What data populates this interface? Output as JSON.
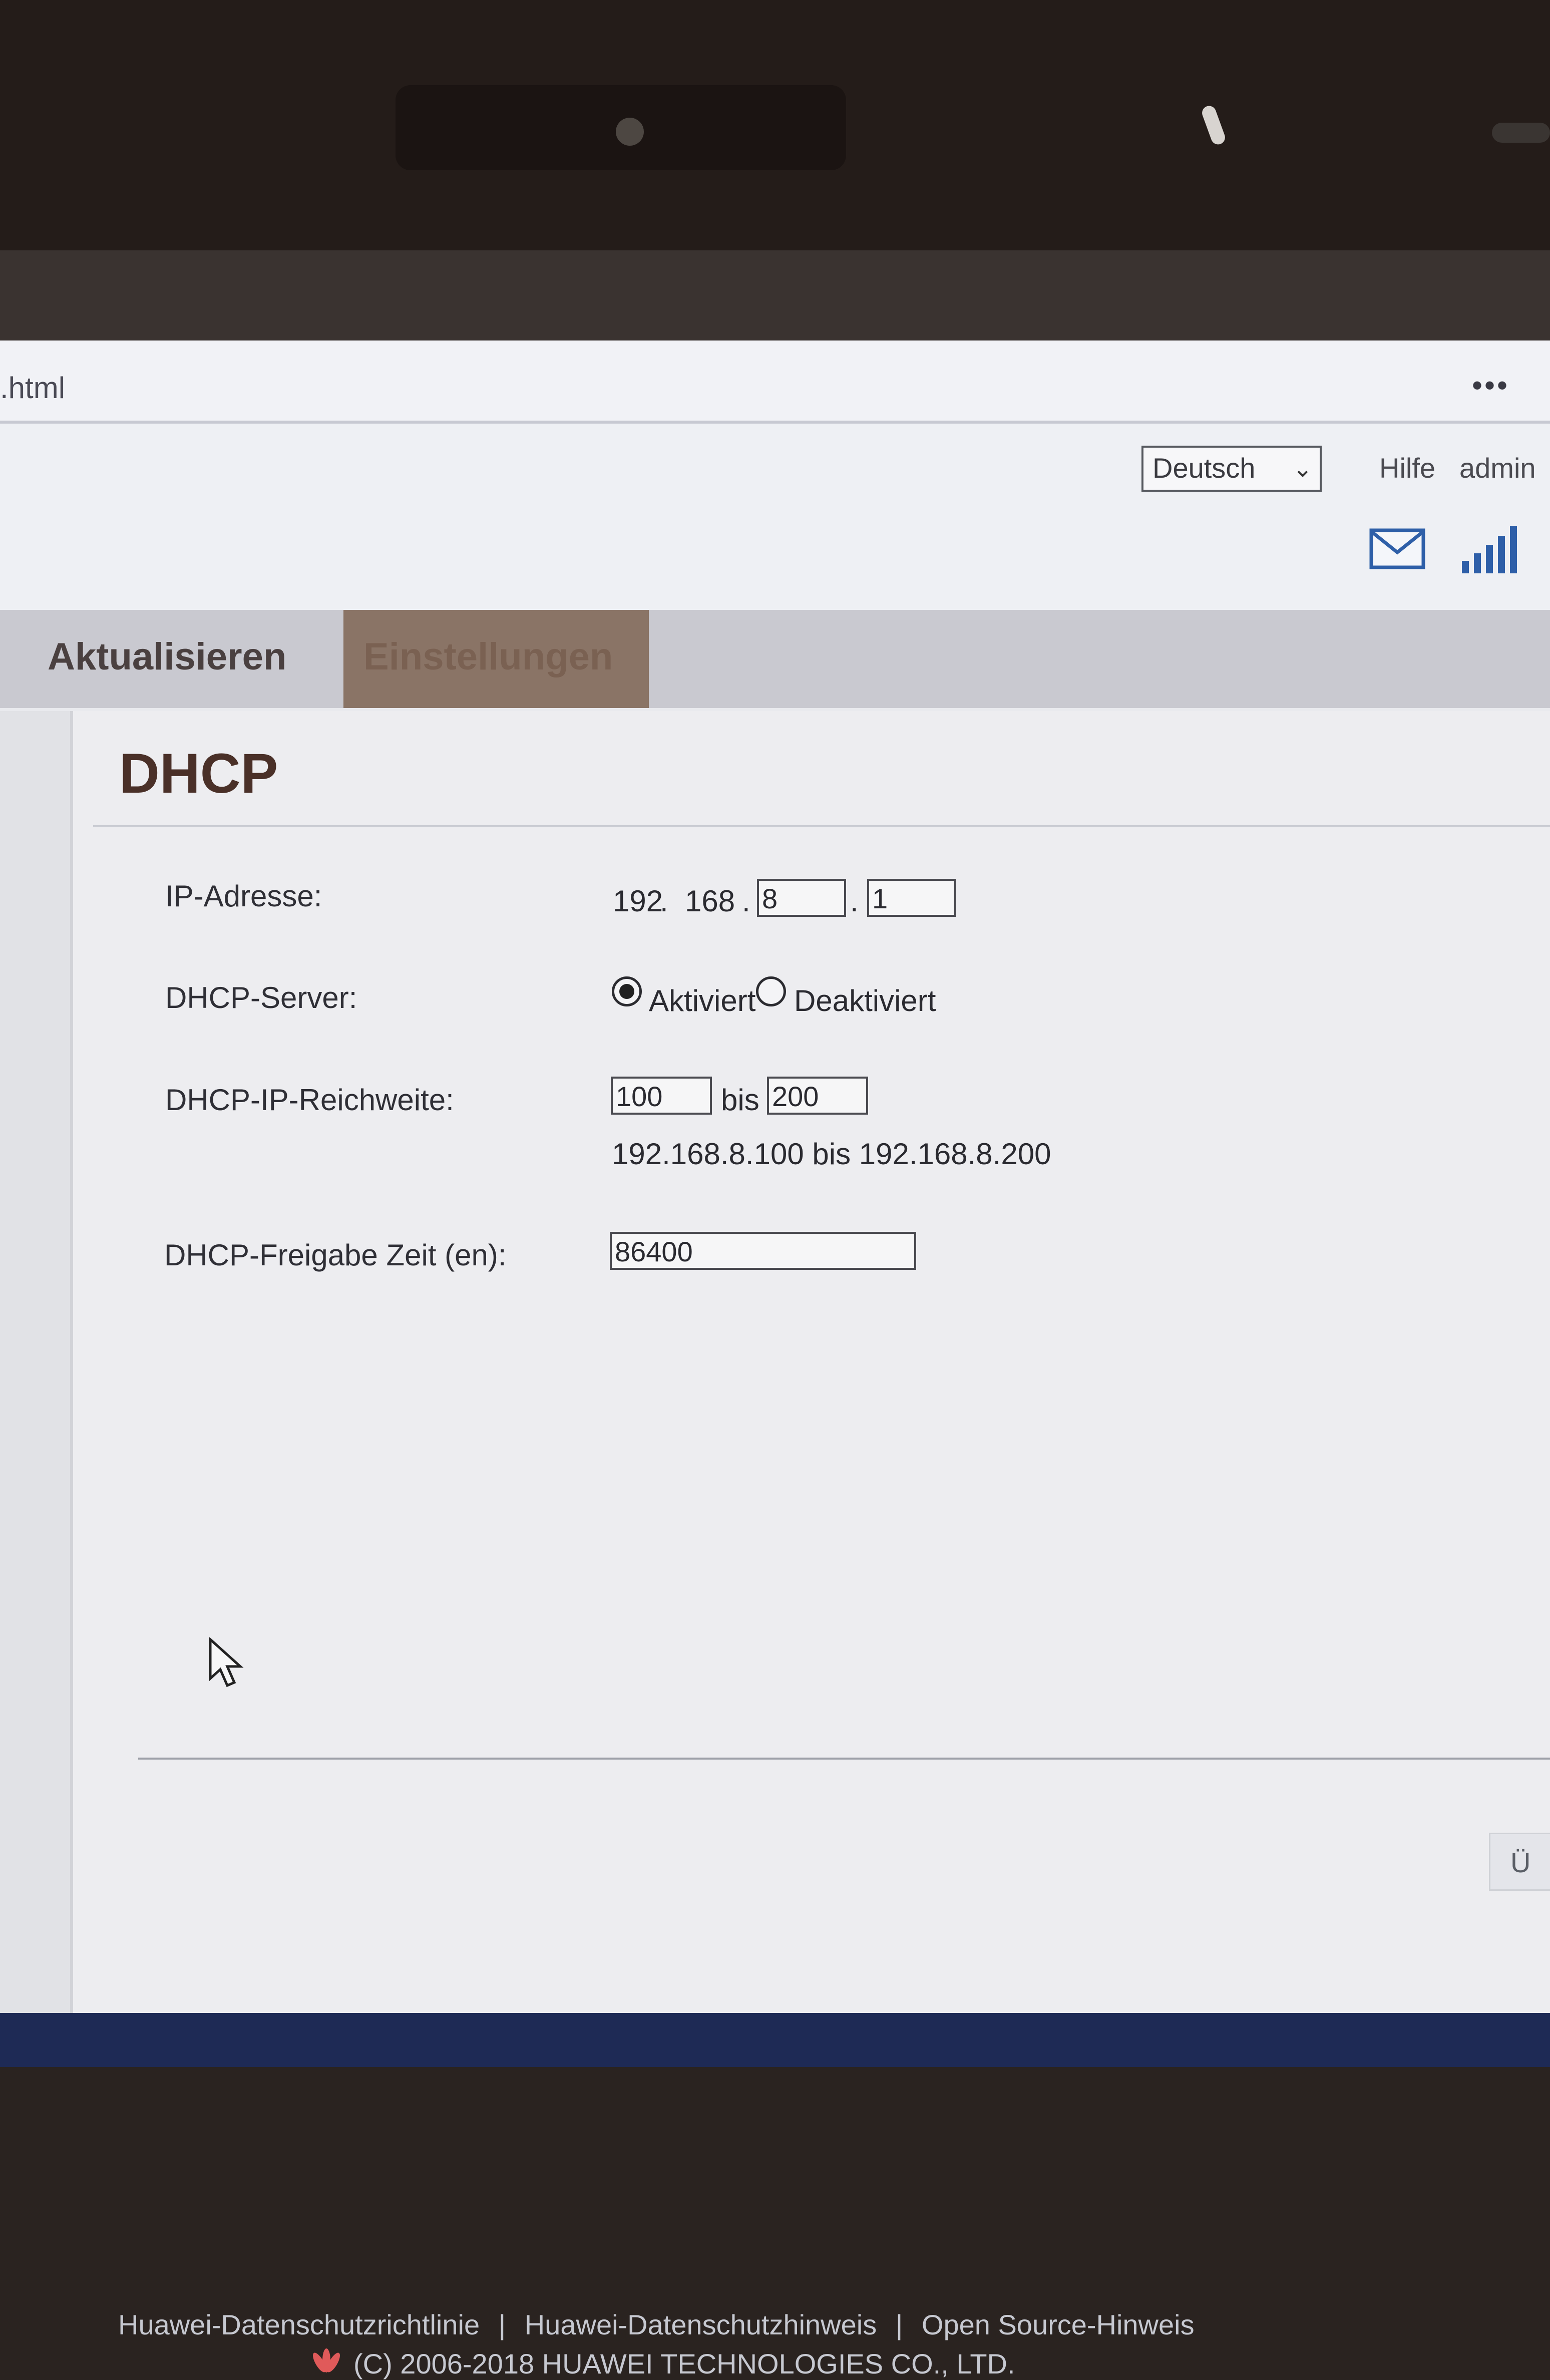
{
  "browser": {
    "url_fragment": ".html",
    "more_menu": "•••"
  },
  "header": {
    "language_select": "Deutsch",
    "help_link": "Hilfe",
    "admin_link": "admin",
    "icons": [
      "mail-icon",
      "signal-strength-icon"
    ]
  },
  "nav": {
    "tabs": [
      {
        "label": "Aktualisieren"
      },
      {
        "label": "Einstellungen",
        "active": true
      }
    ]
  },
  "dhcp": {
    "title": "DHCP",
    "ip_label": "IP-Adresse:",
    "ip_fixed_a": "192",
    "ip_fixed_b": "168",
    "ip_octet3": "8",
    "ip_octet4": "1",
    "server_label": "DHCP-Server:",
    "server_on_label": "Aktiviert",
    "server_off_label": "Deaktiviert",
    "server_enabled": true,
    "range_label": "DHCP-IP-Reichweite:",
    "range_start": "100",
    "range_to": "bis",
    "range_end": "200",
    "range_summary": "192.168.8.100 bis 192.168.8.200",
    "lease_label": "DHCP-Freigabe Zeit (en):",
    "lease_value": "86400",
    "apply_label": "Ü"
  },
  "footer": {
    "links": [
      "Huawei-Datenschutzrichtlinie",
      "|",
      "Huawei-Datenschutzhinweis",
      "|",
      "Open Source-Hinweis"
    ],
    "copyright": "(C) 2006-2018 HUAWEI TECHNOLOGIES CO., LTD."
  }
}
